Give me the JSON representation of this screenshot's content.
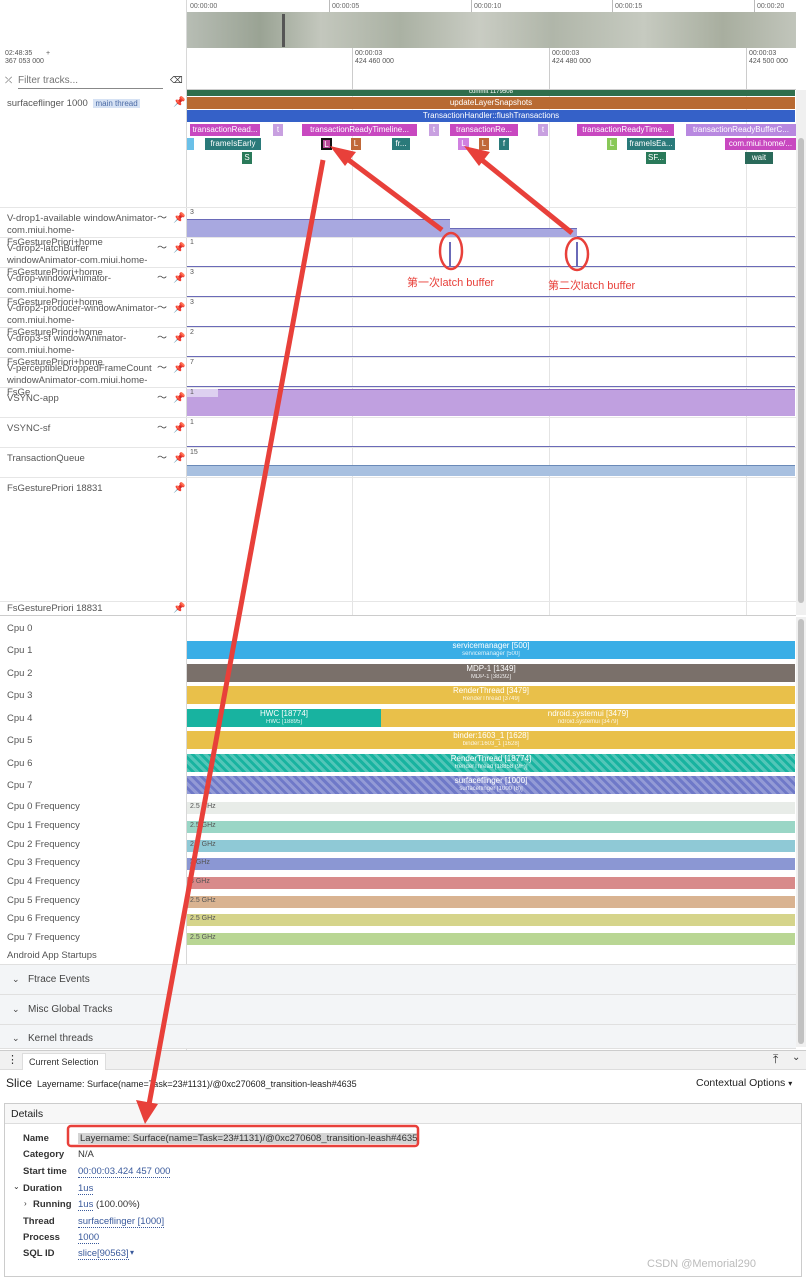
{
  "timeline": {
    "top_ticks": [
      "00:00:00",
      "00:00:05",
      "00:00:10",
      "00:00:15",
      "00:00:20"
    ],
    "origin_time": "02:48:35",
    "origin_ns": "367 053 000",
    "origin_plus": "+",
    "ticks": [
      {
        "t": "00:00:03",
        "ns": "424 460 000"
      },
      {
        "t": "00:00:03",
        "ns": "424 480 000"
      },
      {
        "t": "00:00:03",
        "ns": "424 500 000"
      }
    ]
  },
  "filter": {
    "placeholder": "Filter tracks..."
  },
  "sf_track": {
    "label": "surfaceflinger 1000",
    "badge": "main thread",
    "commit": "commit 1179508",
    "update": "updateLayerSnapshots",
    "flush": "TransactionHandler::flushTransactions",
    "tx_slices": [
      "transactionRead...",
      "t",
      "transactionReadyTimeline...",
      "t",
      "transactionRe...",
      "t",
      "transactionReadyTime...",
      "transactionReadyBufferC..."
    ],
    "sub_slices": [
      "frameIsEarly",
      "L",
      "L",
      "fr...",
      "L",
      "L",
      "f",
      "L",
      "frameIsEa...",
      "com.miui.home/..."
    ],
    "deep_slices": [
      "S",
      "SF...",
      "wait"
    ]
  },
  "counter_tracks": [
    {
      "label": "V-drop1-available windowAnimator-com.miui.home-FsGesturePriori+home",
      "value": "3"
    },
    {
      "label": "V-drop2-latchBuffer windowAnimator-com.miui.home-FsGesturePriori+home",
      "value": "1"
    },
    {
      "label": "V-drop-windowAnimator-com.miui.home-FsGesturePriori+home",
      "value": "3"
    },
    {
      "label": "V-drop2-producer-windowAnimator-com.miui.home-FsGesturePriori+home",
      "value": "3"
    },
    {
      "label": "V-drop3-sf windowAnimator-com.miui.home-FsGesturePriori+home",
      "value": "2"
    },
    {
      "label": "V-perceptibleDroppedFrameCount windowAnimator-com.miui.home-FsGe",
      "value": "7"
    },
    {
      "label": "VSYNC-app",
      "value": "1"
    },
    {
      "label": "VSYNC-sf",
      "value": "1"
    },
    {
      "label": "TransactionQueue",
      "value": "15"
    }
  ],
  "annotations": {
    "first_latch": "第一次latch buffer",
    "second_latch": "第二次latch buffer"
  },
  "process_tracks": [
    "FsGesturePriori 18831",
    "FsGesturePriori 18831"
  ],
  "cpus": [
    {
      "label": "Cpu 0",
      "name": "",
      "sub": "",
      "color": ""
    },
    {
      "label": "Cpu 1",
      "name": "servicemanager [500]",
      "sub": "servicemanager [500]",
      "color": "#3aaee6"
    },
    {
      "label": "Cpu 2",
      "name": "MDP-1 [1349]",
      "sub": "MDP-1 [38292]",
      "color": "#7a706a"
    },
    {
      "label": "Cpu 3",
      "name": "RenderThread [3479]",
      "sub": "RenderThread [3749]",
      "color": "#e9c04a"
    },
    {
      "label": "Cpu 4",
      "name": "HWC [18774]",
      "sub": "HWC [18895]",
      "name2": "ndroid.systemui [3479]",
      "sub2": "ndroid.systemui [3479]",
      "color": "#18b3a0",
      "color2": "#e9c04a"
    },
    {
      "label": "Cpu 5",
      "name": "binder:1603_1 [1628]",
      "sub": "binder:1603_1 [1628]",
      "color": "#e9c04a"
    },
    {
      "label": "Cpu 6",
      "name": "RenderThread [18774]",
      "sub": "RenderThread [18858 (9F)]",
      "color": "#18b3a0"
    },
    {
      "label": "Cpu 7",
      "name": "surfaceflinger [1000]",
      "sub": "surfaceflinger [1000 (8)]",
      "color": "#6f79c8"
    }
  ],
  "freqs": [
    {
      "label": "Cpu 0 Frequency",
      "value": "2.5 GHz",
      "color": "#e8ece8"
    },
    {
      "label": "Cpu 1 Frequency",
      "value": "2.5 GHz",
      "color": "#9ad6c6"
    },
    {
      "label": "Cpu 2 Frequency",
      "value": "2.5 GHz",
      "color": "#8fc9d6"
    },
    {
      "label": "Cpu 3 Frequency",
      "value": "3 GHz",
      "color": "#8b97d3"
    },
    {
      "label": "Cpu 4 Frequency",
      "value": "3 GHz",
      "color": "#d88a8a"
    },
    {
      "label": "Cpu 5 Frequency",
      "value": "2.5 GHz",
      "color": "#d9b391"
    },
    {
      "label": "Cpu 6 Frequency",
      "value": "2.5 GHz",
      "color": "#d5d48b"
    },
    {
      "label": "Cpu 7 Frequency",
      "value": "2.5 GHz",
      "color": "#b9d694"
    }
  ],
  "app_startups": "Android App Startups",
  "groups": [
    "Ftrace Events",
    "Misc Global Tracks",
    "Kernel threads"
  ],
  "bottom": {
    "tab": "Current Selection",
    "kind": "Slice",
    "title": "Layername: Surface(name=Task=23#1131)/@0xc270608_transition-leash#4635",
    "contextual": "Contextual Options",
    "details_header": "Details",
    "rows": [
      {
        "label": "Name",
        "value": "Layername: Surface(name=Task=23#1131)/@0xc270608_transition-leash#4635"
      },
      {
        "label": "Category",
        "value": "N/A"
      },
      {
        "label": "Start time",
        "value": "00:00:03.424 457 000"
      },
      {
        "label": "Duration",
        "value": "1us"
      },
      {
        "label": "Running",
        "value": "1us",
        "extra": "(100.00%)"
      },
      {
        "label": "Thread",
        "value": "surfaceflinger [1000]"
      },
      {
        "label": "Process",
        "value": "1000"
      },
      {
        "label": "SQL ID",
        "value": "slice[90563]"
      }
    ],
    "watermark": "CSDN @Memorial290"
  },
  "colors": {
    "accent_red": "#e8403a",
    "link": "#3a5a9c"
  }
}
